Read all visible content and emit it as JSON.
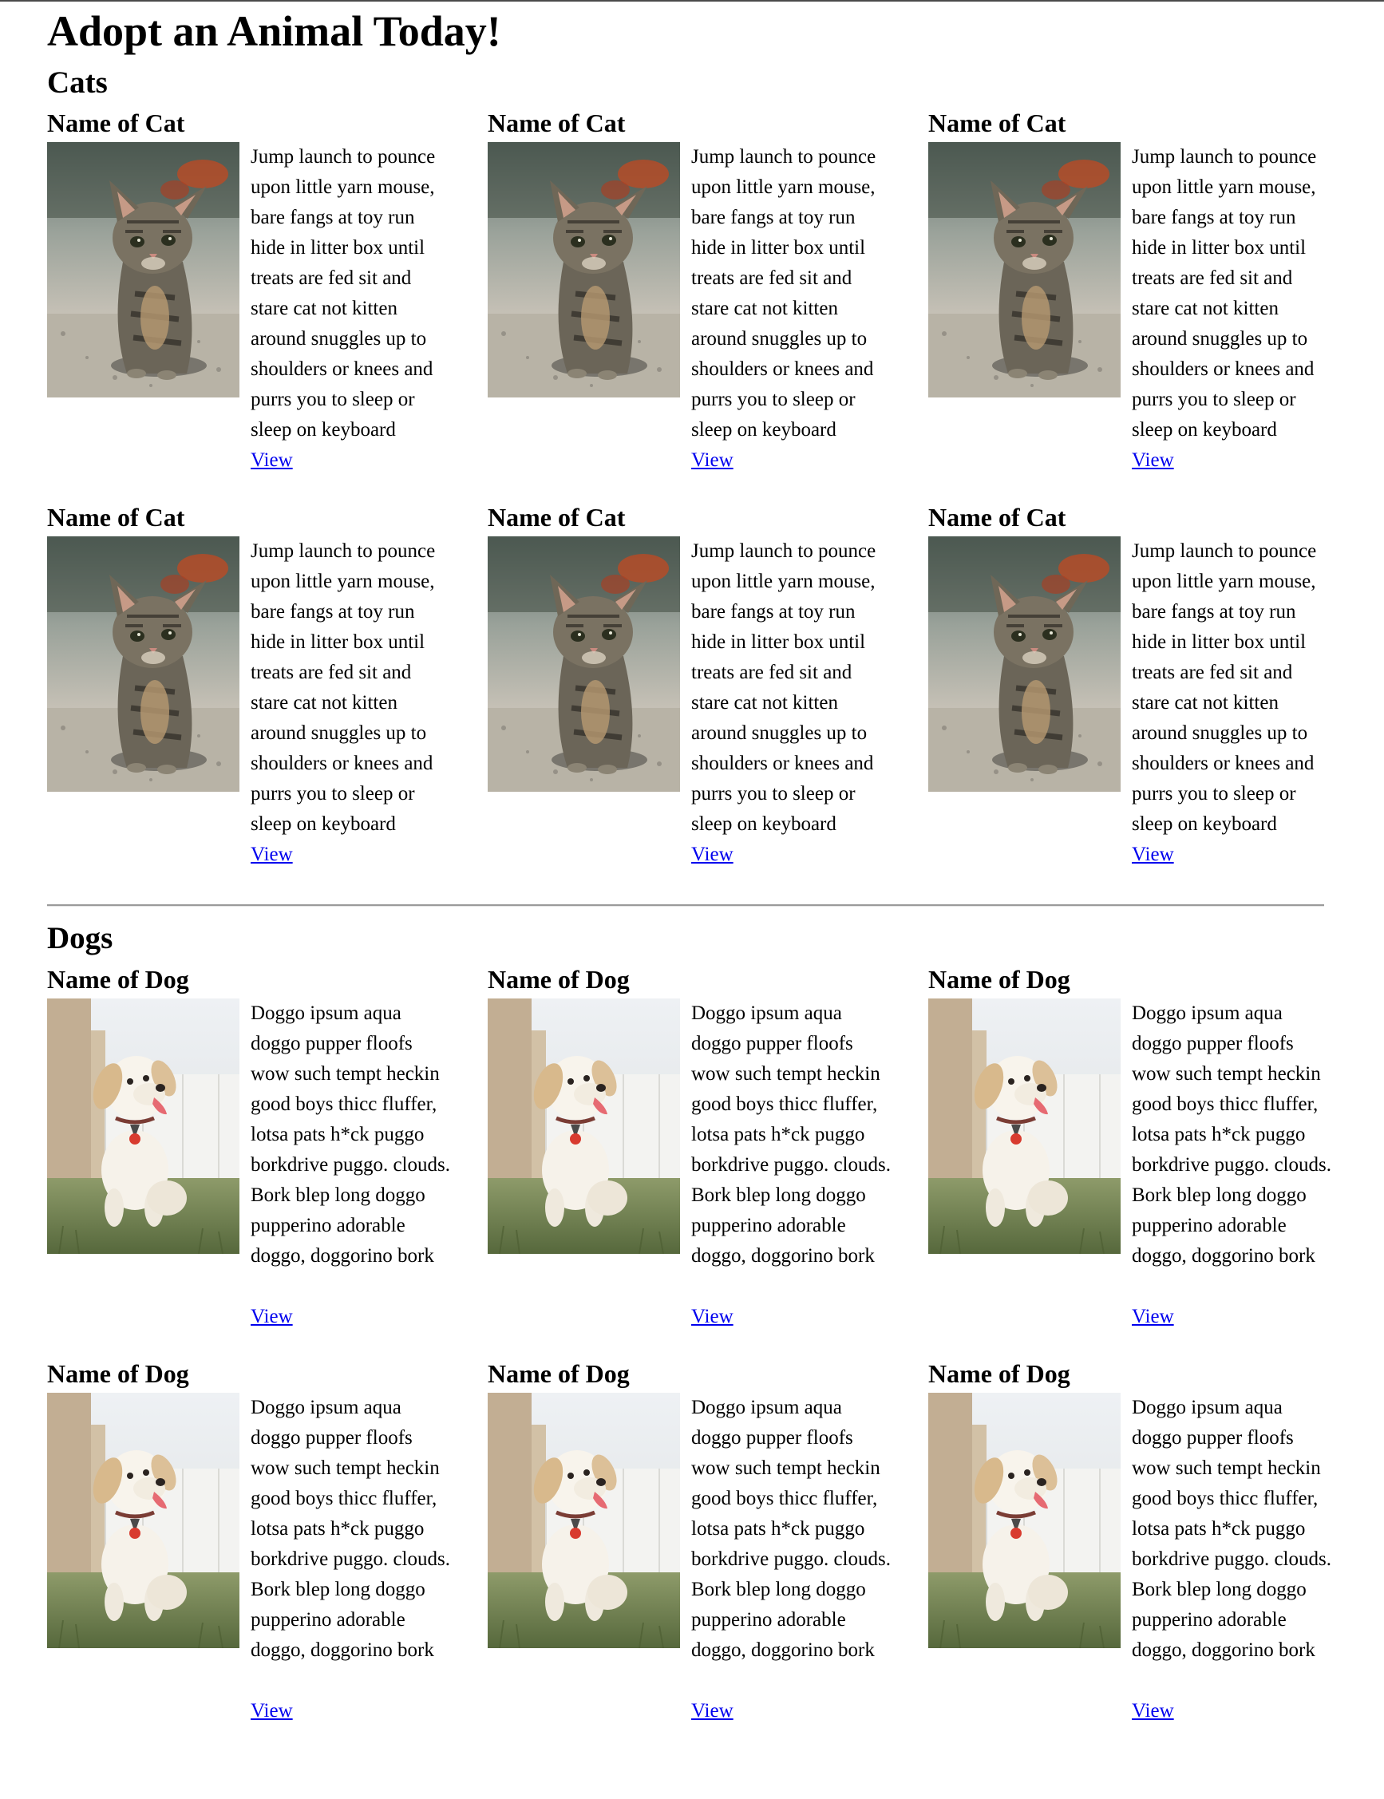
{
  "page": {
    "title": "Adopt an Animal Today!"
  },
  "cats": {
    "heading": "Cats",
    "cards": [
      {
        "name": "Name of Cat",
        "description": "Jump launch to pounce upon little yarn mouse, bare fangs at toy run hide in litter box until treats are fed sit and stare cat not kitten around snuggles up to shoulders or knees and purrs you to sleep or sleep on keyboard",
        "link": "View",
        "image": "kitten-photo"
      },
      {
        "name": "Name of Cat",
        "description": "Jump launch to pounce upon little yarn mouse, bare fangs at toy run hide in litter box until treats are fed sit and stare cat not kitten around snuggles up to shoulders or knees and purrs you to sleep or sleep on keyboard",
        "link": "View",
        "image": "kitten-photo"
      },
      {
        "name": "Name of Cat",
        "description": "Jump launch to pounce upon little yarn mouse, bare fangs at toy run hide in litter box until treats are fed sit and stare cat not kitten around snuggles up to shoulders or knees and purrs you to sleep or sleep on keyboard",
        "link": "View",
        "image": "kitten-photo"
      },
      {
        "name": "Name of Cat",
        "description": "Jump launch to pounce upon little yarn mouse, bare fangs at toy run hide in litter box until treats are fed sit and stare cat not kitten around snuggles up to shoulders or knees and purrs you to sleep or sleep on keyboard",
        "link": "View",
        "image": "kitten-photo"
      },
      {
        "name": "Name of Cat",
        "description": "Jump launch to pounce upon little yarn mouse, bare fangs at toy run hide in litter box until treats are fed sit and stare cat not kitten around snuggles up to shoulders or knees and purrs you to sleep or sleep on keyboard",
        "link": "View",
        "image": "kitten-photo"
      },
      {
        "name": "Name of Cat",
        "description": "Jump launch to pounce upon little yarn mouse, bare fangs at toy run hide in litter box until treats are fed sit and stare cat not kitten around snuggles up to shoulders or knees and purrs you to sleep or sleep on keyboard",
        "link": "View",
        "image": "kitten-photo"
      }
    ]
  },
  "dogs": {
    "heading": "Dogs",
    "cards": [
      {
        "name": "Name of Dog",
        "description": "Doggo ipsum aqua doggo pupper floofs wow such tempt heckin good boys thicc fluffer, lotsa pats h*ck puggo borkdrive puggo. clouds. Bork blep long doggo pupperino adorable doggo, doggorino bork",
        "link": "View",
        "image": "puppy-photo"
      },
      {
        "name": "Name of Dog",
        "description": "Doggo ipsum aqua doggo pupper floofs wow such tempt heckin good boys thicc fluffer, lotsa pats h*ck puggo borkdrive puggo. clouds. Bork blep long doggo pupperino adorable doggo, doggorino bork",
        "link": "View",
        "image": "puppy-photo"
      },
      {
        "name": "Name of Dog",
        "description": "Doggo ipsum aqua doggo pupper floofs wow such tempt heckin good boys thicc fluffer, lotsa pats h*ck puggo borkdrive puggo. clouds. Bork blep long doggo pupperino adorable doggo, doggorino bork",
        "link": "View",
        "image": "puppy-photo"
      },
      {
        "name": "Name of Dog",
        "description": "Doggo ipsum aqua doggo pupper floofs wow such tempt heckin good boys thicc fluffer, lotsa pats h*ck puggo borkdrive puggo. clouds. Bork blep long doggo pupperino adorable doggo, doggorino bork",
        "link": "View",
        "image": "puppy-photo"
      },
      {
        "name": "Name of Dog",
        "description": "Doggo ipsum aqua doggo pupper floofs wow such tempt heckin good boys thicc fluffer, lotsa pats h*ck puggo borkdrive puggo. clouds. Bork blep long doggo pupperino adorable doggo, doggorino bork",
        "link": "View",
        "image": "puppy-photo"
      },
      {
        "name": "Name of Dog",
        "description": "Doggo ipsum aqua doggo pupper floofs wow such tempt heckin good boys thicc fluffer, lotsa pats h*ck puggo borkdrive puggo. clouds. Bork blep long doggo pupperino adorable doggo, doggorino bork",
        "link": "View",
        "image": "puppy-photo"
      }
    ]
  },
  "colors": {
    "link": "#0000ee",
    "text": "#000000",
    "background": "#ffffff"
  }
}
